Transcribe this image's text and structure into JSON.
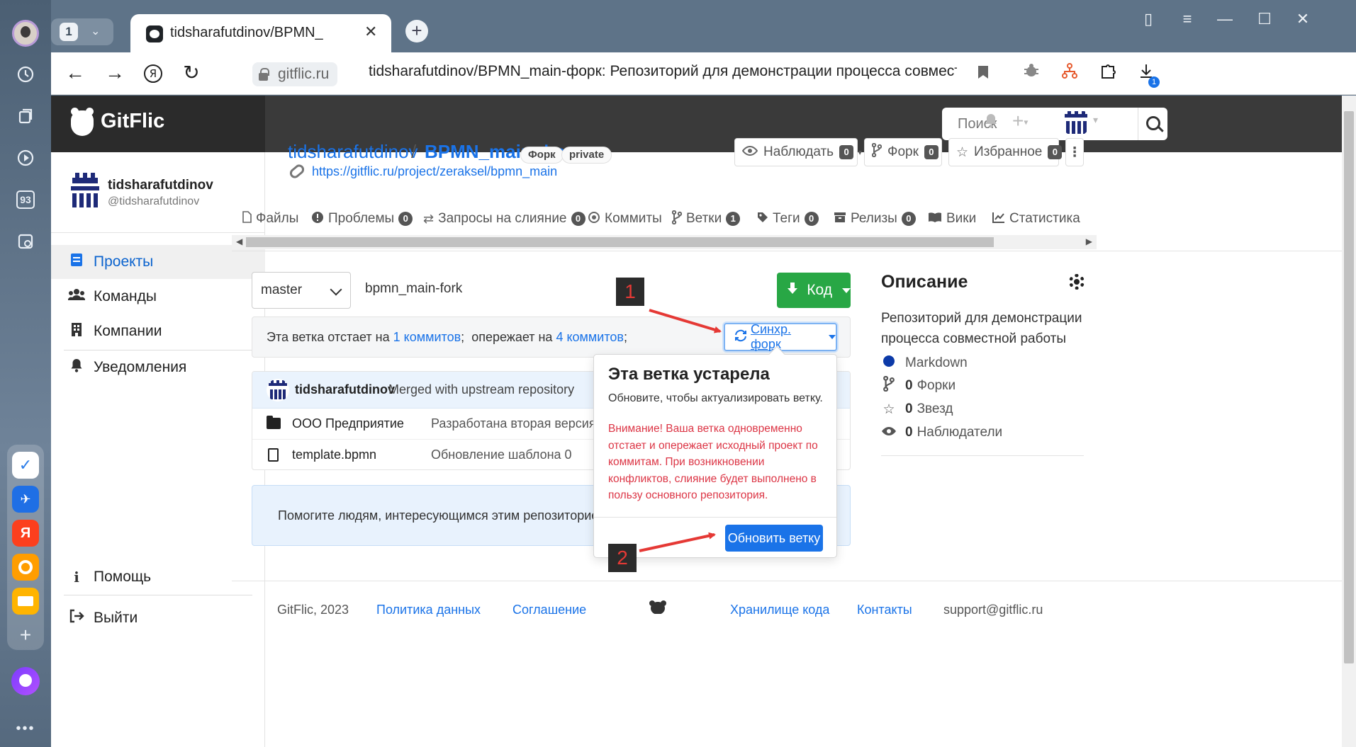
{
  "browser": {
    "tab_count": "1",
    "tab_title": "tidsharafutdinov/BPMN_",
    "domain": "gitflic.ru",
    "page_title": "tidsharafutdinov/BPMN_main-форк: Репозиторий для демонстрации процесса совместно...",
    "rail_badge": "93",
    "downloads_badge": "1"
  },
  "header": {
    "brand": "GitFlic",
    "search_placeholder": "Поиск"
  },
  "sidebar": {
    "username": "tidsharafutdinov",
    "handle": "@tidsharafutdinov",
    "items": [
      {
        "label": "Проекты",
        "icon": "projects-icon"
      },
      {
        "label": "Команды",
        "icon": "teams-icon"
      },
      {
        "label": "Компании",
        "icon": "company-icon"
      },
      {
        "label": "Уведомления",
        "icon": "bell-icon"
      }
    ],
    "help": "Помощь",
    "logout": "Выйти"
  },
  "repo": {
    "owner": "tidsharafutdinov",
    "slash": "/",
    "name": "BPMN_main-форк",
    "fork_pill": "Форк",
    "private_pill": "private",
    "url": "https://gitflic.ru/project/zeraksel/bpmn_main",
    "watch_label": "Наблюдать",
    "watch_count": "0",
    "fork_label": "Форк",
    "fork_count": "0",
    "fav_label": "Избранное",
    "fav_count": "0"
  },
  "tabs": [
    {
      "label": "Файлы",
      "count": null
    },
    {
      "label": "Проблемы",
      "count": "0"
    },
    {
      "label": "Запросы на слияние",
      "count": "0"
    },
    {
      "label": "Коммиты",
      "count": null
    },
    {
      "label": "Ветки",
      "count": "1"
    },
    {
      "label": "Теги",
      "count": "0"
    },
    {
      "label": "Релизы",
      "count": "0"
    },
    {
      "label": "Вики",
      "count": null
    },
    {
      "label": "Статистика",
      "count": null
    }
  ],
  "branch": {
    "selected": "master",
    "path": "bpmn_main-fork",
    "code_button": "Код"
  },
  "status": {
    "behind_prefix": "Эта ветка отстает на",
    "behind_link": "1 коммитов",
    "ahead_prefix": "опережает на",
    "ahead_link": "4 коммитов",
    "sync_button": "Синхр. форк"
  },
  "commit": {
    "author": "tidsharafutdinov",
    "message": "Merged with upstream repository"
  },
  "files": [
    {
      "name": "ООО Предприятие",
      "message": "Разработана вторая версия пр",
      "type": "folder"
    },
    {
      "name": "template.bpmn",
      "message": "Обновление шаблона 0",
      "type": "file"
    }
  ],
  "help_text": "Помогите людям, интересующимся этим репозиторием, пон",
  "popover": {
    "title": "Эта ветка устарела",
    "subtitle": "Обновите, чтобы актуализировать ветку.",
    "warning": "Внимание! Ваша ветка одновременно отстает и опережает исходный проект по коммитам. При возникновении конфликтов, слияние будет выполнено в пользу основного репозитория.",
    "button": "Обновить ветку"
  },
  "description": {
    "title": "Описание",
    "text": "Репозиторий для демонстрации процесса совместной работы",
    "language": "Markdown",
    "language_color": "#0c3aa8",
    "forks_count": "0",
    "forks_label": "Форки",
    "stars_count": "0",
    "stars_label": "Звезд",
    "watchers_count": "0",
    "watchers_label": "Наблюдатели"
  },
  "annotations": {
    "step1": "1",
    "step2": "2",
    "arrow_color": "#e53935"
  },
  "footer": {
    "copyright": "GitFlic, 2023",
    "policy": "Политика данных",
    "agreement": "Соглашение",
    "storage": "Хранилище кода",
    "contacts": "Контакты",
    "email": "support@gitflic.ru"
  }
}
